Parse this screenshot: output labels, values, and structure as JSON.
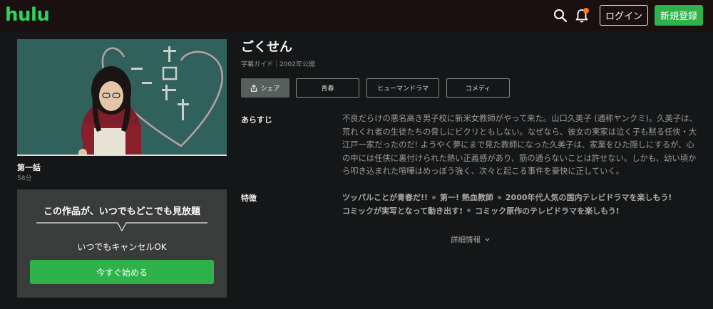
{
  "header": {
    "logo": "hulu",
    "login_label": "ログイン",
    "signup_label": "新規登録",
    "icons": [
      "search-icon",
      "bell-icon"
    ]
  },
  "episode": {
    "title": "第一話",
    "duration": "58分"
  },
  "promo": {
    "title": "この作品が、いつでもどこでも見放題",
    "subtitle": "いつでもキャンセルOK",
    "cta_label": "今すぐ始める"
  },
  "show": {
    "title": "ごくせん",
    "meta": "字幕ガイド｜2002年公開",
    "share_label": "シェア",
    "tags": [
      "青春",
      "ヒューマンドラマ",
      "コメディ"
    ]
  },
  "synopsis": {
    "label": "あらすじ",
    "text": "不良だらけの悪名高き男子校に新米女教師がやって来た。山口久美子 (通称ヤンクミ)。久美子は、荒れくれ者の生徒たちの脅しにビクリともしない。なぜなら、彼女の実家は泣く子も黙る任侠・大江戸一家だったのだ! ようやく夢にまで見た教師になった久美子は、家業をひた隠しにするが、心の中には任侠に裏付けられた熱い正義感があり、筋の通らないことは許せない。しかも、幼い頃から叩き込まれた喧嘩はめっぽう強く、次々と起こる事件を豪快に正していく。"
  },
  "features": {
    "label": "特徴",
    "items": [
      "ツッパルことが青春だ!!",
      "第一! 熱血教師",
      "2000年代人気の国内テレビドラマを楽しもう!",
      "コミックが実写となって動き出す!",
      "コミック原作のテレビドラマを楽しもう!"
    ]
  },
  "more_label": "詳細情報",
  "colors": {
    "brand_green": "#2fd35c",
    "button_green": "#2fb24a",
    "notification_dot": "#ff7a1a",
    "background": "#151617"
  }
}
